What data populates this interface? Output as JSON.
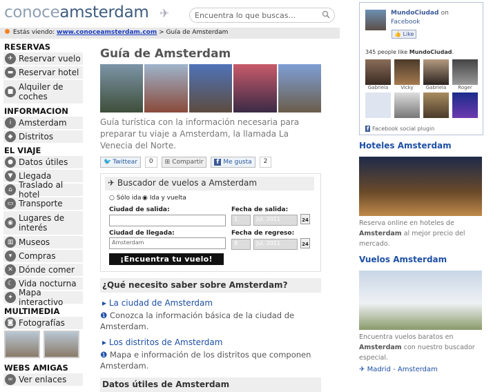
{
  "header": {
    "logo_part1": "conoce",
    "logo_part2": "amsterdam",
    "search_placeholder": "Encuentra lo que buscas..."
  },
  "breadcrumb": {
    "prefix": "Estás viendo:",
    "link": "www.conoceamsterdam.com",
    "sep": ">",
    "current": "Guía de Amsterdam"
  },
  "sidebar": {
    "reservas": {
      "title": "RESERVAS",
      "items": [
        "Reservar vuelo",
        "Reservar hotel",
        "Alquiler de coches"
      ]
    },
    "informacion": {
      "title": "INFORMACION",
      "items": [
        "Amsterdam",
        "Distritos"
      ]
    },
    "viaje": {
      "title": "EL VIAJE",
      "items": [
        "Datos útiles",
        "Llegada",
        "Traslado al hotel",
        "Transporte",
        "Lugares de interés",
        "Museos",
        "Compras",
        "Dónde comer",
        "Vida nocturna",
        "Mapa interactivo"
      ]
    },
    "multimedia": {
      "title": "MULTIMEDIA",
      "items": [
        "Fotografías"
      ]
    },
    "webs": {
      "title": "WEBS AMIGAS",
      "items": [
        "Ver enlaces"
      ]
    }
  },
  "main": {
    "title": "Guía de Amsterdam",
    "intro": "Guía turística con la información necesaria para preparar tu viaje a Amsterdam, la llamada La Venecia del Norte.",
    "share": {
      "twitter": "Twittear",
      "twitter_count": "0",
      "compartir": "Compartir",
      "like": "Me gusta",
      "like_count": "2"
    },
    "flight": {
      "title": "Buscador de vuelos a Amsterdam",
      "solo_ida": "Sólo ida",
      "ida_vuelta": "Ida y vuelta",
      "origen_label": "Ciudad de salida:",
      "destino_label": "Ciudad de llegada:",
      "destino_value": "Amsterdam",
      "salida_label": "Fecha de salida:",
      "salida_day": "1",
      "salida_month": "jul. 2011",
      "regreso_label": "Fecha de regreso:",
      "regreso_day": "8",
      "regreso_month": "jul. 2011",
      "cal_num": "24",
      "button": "¡Encuentra tu vuelo!"
    },
    "section_q": "¿Qué necesito saber sobre Amsterdam?",
    "links": [
      {
        "label": "La ciudad de Amsterdam",
        "desc": "Conozca la información básica de la ciudad de Amsterdam."
      },
      {
        "label": "Los distritos de Amsterdam",
        "desc": "Mapa e información de los distritos que componen Amsterdam."
      }
    ],
    "section_datos": "Datos útiles de Amsterdam"
  },
  "right": {
    "fb": {
      "page": "MundoCiudad",
      "on": "on",
      "network": "Facebook",
      "like": "Like",
      "count_prefix": "345 people like",
      "count_name": "MundoCiudad",
      "faces": [
        "Gabriela",
        "Vicky",
        "Gabriela",
        "Roger",
        "",
        "",
        "",
        ""
      ],
      "plugin": "Facebook social plugin"
    },
    "hoteles_title": "Hoteles Amsterdam",
    "hoteles_text1": "Reserva online en hoteles de",
    "hoteles_bold": "Amsterdam",
    "hoteles_text2": "al mejor precio del mercado.",
    "vuelos_title": "Vuelos Amsterdam",
    "vuelos_text1": "Encuentra vuelos baratos en",
    "vuelos_bold": "Amsterdam",
    "vuelos_text2": "con nuestro buscador especial.",
    "vuelos_link": "Madrid - Amsterdam"
  }
}
